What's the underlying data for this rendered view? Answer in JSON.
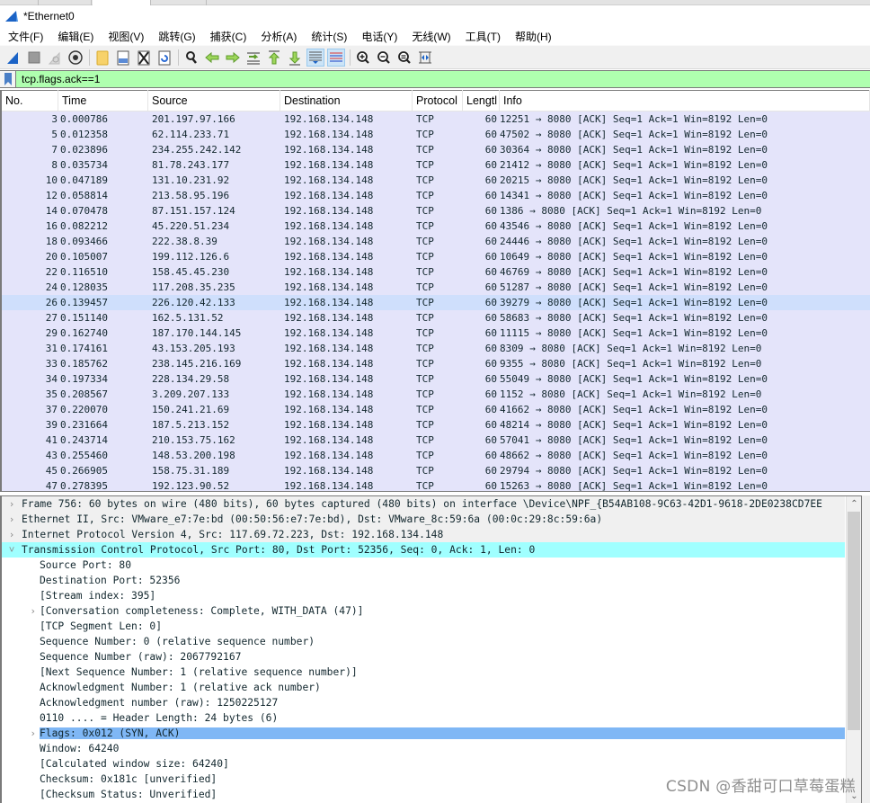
{
  "window": {
    "title": "*Ethernet0"
  },
  "menu": [
    {
      "label": "文件(F)"
    },
    {
      "label": "编辑(E)"
    },
    {
      "label": "视图(V)"
    },
    {
      "label": "跳转(G)"
    },
    {
      "label": "捕获(C)"
    },
    {
      "label": "分析(A)"
    },
    {
      "label": "统计(S)"
    },
    {
      "label": "电话(Y)"
    },
    {
      "label": "无线(W)"
    },
    {
      "label": "工具(T)"
    },
    {
      "label": "帮助(H)"
    }
  ],
  "toolbar": {
    "buttons": [
      {
        "icon": "shark-fin-start-capture-icon"
      },
      {
        "icon": "stop-capture-icon"
      },
      {
        "icon": "restart-capture-icon"
      },
      {
        "icon": "capture-options-gear-icon"
      },
      {
        "icon": "open-file-folder-icon"
      },
      {
        "icon": "save-file-icon"
      },
      {
        "icon": "close-file-icon"
      },
      {
        "icon": "reload-file-icon"
      },
      {
        "icon": "find-packet-magnifier-icon"
      },
      {
        "icon": "go-back-arrow-icon"
      },
      {
        "icon": "go-forward-arrow-icon"
      },
      {
        "icon": "go-to-packet-icon"
      },
      {
        "icon": "go-first-packet-icon"
      },
      {
        "icon": "go-last-packet-icon"
      },
      {
        "icon": "auto-scroll-icon",
        "active": true
      },
      {
        "icon": "colorize-icon",
        "active": true
      },
      {
        "icon": "zoom-in-icon"
      },
      {
        "icon": "zoom-out-icon"
      },
      {
        "icon": "zoom-normal-icon"
      },
      {
        "icon": "resize-columns-icon"
      }
    ]
  },
  "filter": {
    "value": "tcp.flags.ack==1"
  },
  "packet_list": {
    "columns": [
      "No.",
      "Time",
      "Source",
      "Destination",
      "Protocol",
      "Lengtl",
      "Info"
    ],
    "rows": [
      {
        "no": "3",
        "time": "0.000786",
        "src": "201.197.97.166",
        "dst": "192.168.134.148",
        "proto": "TCP",
        "len": "60",
        "info": "12251 → 8080 [ACK] Seq=1 Ack=1 Win=8192 Len=0"
      },
      {
        "no": "5",
        "time": "0.012358",
        "src": "62.114.233.71",
        "dst": "192.168.134.148",
        "proto": "TCP",
        "len": "60",
        "info": "47502 → 8080 [ACK] Seq=1 Ack=1 Win=8192 Len=0"
      },
      {
        "no": "7",
        "time": "0.023896",
        "src": "234.255.242.142",
        "dst": "192.168.134.148",
        "proto": "TCP",
        "len": "60",
        "info": "30364 → 8080 [ACK] Seq=1 Ack=1 Win=8192 Len=0"
      },
      {
        "no": "8",
        "time": "0.035734",
        "src": "81.78.243.177",
        "dst": "192.168.134.148",
        "proto": "TCP",
        "len": "60",
        "info": "21412 → 8080 [ACK] Seq=1 Ack=1 Win=8192 Len=0"
      },
      {
        "no": "10",
        "time": "0.047189",
        "src": "131.10.231.92",
        "dst": "192.168.134.148",
        "proto": "TCP",
        "len": "60",
        "info": "20215 → 8080 [ACK] Seq=1 Ack=1 Win=8192 Len=0"
      },
      {
        "no": "12",
        "time": "0.058814",
        "src": "213.58.95.196",
        "dst": "192.168.134.148",
        "proto": "TCP",
        "len": "60",
        "info": "14341 → 8080 [ACK] Seq=1 Ack=1 Win=8192 Len=0"
      },
      {
        "no": "14",
        "time": "0.070478",
        "src": "87.151.157.124",
        "dst": "192.168.134.148",
        "proto": "TCP",
        "len": "60",
        "info": "1386 → 8080 [ACK] Seq=1 Ack=1 Win=8192 Len=0"
      },
      {
        "no": "16",
        "time": "0.082212",
        "src": "45.220.51.234",
        "dst": "192.168.134.148",
        "proto": "TCP",
        "len": "60",
        "info": "43546 → 8080 [ACK] Seq=1 Ack=1 Win=8192 Len=0"
      },
      {
        "no": "18",
        "time": "0.093466",
        "src": "222.38.8.39",
        "dst": "192.168.134.148",
        "proto": "TCP",
        "len": "60",
        "info": "24446 → 8080 [ACK] Seq=1 Ack=1 Win=8192 Len=0"
      },
      {
        "no": "20",
        "time": "0.105007",
        "src": "199.112.126.6",
        "dst": "192.168.134.148",
        "proto": "TCP",
        "len": "60",
        "info": "10649 → 8080 [ACK] Seq=1 Ack=1 Win=8192 Len=0"
      },
      {
        "no": "22",
        "time": "0.116510",
        "src": "158.45.45.230",
        "dst": "192.168.134.148",
        "proto": "TCP",
        "len": "60",
        "info": "46769 → 8080 [ACK] Seq=1 Ack=1 Win=8192 Len=0"
      },
      {
        "no": "24",
        "time": "0.128035",
        "src": "117.208.35.235",
        "dst": "192.168.134.148",
        "proto": "TCP",
        "len": "60",
        "info": "51287 → 8080 [ACK] Seq=1 Ack=1 Win=8192 Len=0"
      },
      {
        "no": "26",
        "time": "0.139457",
        "src": "226.120.42.133",
        "dst": "192.168.134.148",
        "proto": "TCP",
        "len": "60",
        "info": "39279 → 8080 [ACK] Seq=1 Ack=1 Win=8192 Len=0",
        "hover": true
      },
      {
        "no": "27",
        "time": "0.151140",
        "src": "162.5.131.52",
        "dst": "192.168.134.148",
        "proto": "TCP",
        "len": "60",
        "info": "58683 → 8080 [ACK] Seq=1 Ack=1 Win=8192 Len=0"
      },
      {
        "no": "29",
        "time": "0.162740",
        "src": "187.170.144.145",
        "dst": "192.168.134.148",
        "proto": "TCP",
        "len": "60",
        "info": "11115 → 8080 [ACK] Seq=1 Ack=1 Win=8192 Len=0"
      },
      {
        "no": "31",
        "time": "0.174161",
        "src": "43.153.205.193",
        "dst": "192.168.134.148",
        "proto": "TCP",
        "len": "60",
        "info": "8309 → 8080 [ACK] Seq=1 Ack=1 Win=8192 Len=0"
      },
      {
        "no": "33",
        "time": "0.185762",
        "src": "238.145.216.169",
        "dst": "192.168.134.148",
        "proto": "TCP",
        "len": "60",
        "info": "9355 → 8080 [ACK] Seq=1 Ack=1 Win=8192 Len=0"
      },
      {
        "no": "34",
        "time": "0.197334",
        "src": "228.134.29.58",
        "dst": "192.168.134.148",
        "proto": "TCP",
        "len": "60",
        "info": "55049 → 8080 [ACK] Seq=1 Ack=1 Win=8192 Len=0"
      },
      {
        "no": "35",
        "time": "0.208567",
        "src": "3.209.207.133",
        "dst": "192.168.134.148",
        "proto": "TCP",
        "len": "60",
        "info": "1152 → 8080 [ACK] Seq=1 Ack=1 Win=8192 Len=0"
      },
      {
        "no": "37",
        "time": "0.220070",
        "src": "150.241.21.69",
        "dst": "192.168.134.148",
        "proto": "TCP",
        "len": "60",
        "info": "41662 → 8080 [ACK] Seq=1 Ack=1 Win=8192 Len=0"
      },
      {
        "no": "39",
        "time": "0.231664",
        "src": "187.5.213.152",
        "dst": "192.168.134.148",
        "proto": "TCP",
        "len": "60",
        "info": "48214 → 8080 [ACK] Seq=1 Ack=1 Win=8192 Len=0"
      },
      {
        "no": "41",
        "time": "0.243714",
        "src": "210.153.75.162",
        "dst": "192.168.134.148",
        "proto": "TCP",
        "len": "60",
        "info": "57041 → 8080 [ACK] Seq=1 Ack=1 Win=8192 Len=0"
      },
      {
        "no": "43",
        "time": "0.255460",
        "src": "148.53.200.198",
        "dst": "192.168.134.148",
        "proto": "TCP",
        "len": "60",
        "info": "48662 → 8080 [ACK] Seq=1 Ack=1 Win=8192 Len=0"
      },
      {
        "no": "45",
        "time": "0.266905",
        "src": "158.75.31.189",
        "dst": "192.168.134.148",
        "proto": "TCP",
        "len": "60",
        "info": "29794 → 8080 [ACK] Seq=1 Ack=1 Win=8192 Len=0"
      },
      {
        "no": "47",
        "time": "0.278395",
        "src": "192.123.90.52",
        "dst": "192.168.134.148",
        "proto": "TCP",
        "len": "60",
        "info": "15263 → 8080 [ACK] Seq=1 Ack=1 Win=8192 Len=0"
      }
    ]
  },
  "details": {
    "rows": [
      {
        "level": 0,
        "expander": "collapsed",
        "style": "top",
        "text": "Frame 756: 60 bytes on wire (480 bits), 60 bytes captured (480 bits) on interface \\Device\\NPF_{B54AB108-9C63-42D1-9618-2DE0238CD7EE"
      },
      {
        "level": 0,
        "expander": "collapsed",
        "style": "top",
        "text": "Ethernet II, Src: VMware_e7:7e:bd (00:50:56:e7:7e:bd), Dst: VMware_8c:59:6a (00:0c:29:8c:59:6a)"
      },
      {
        "level": 0,
        "expander": "collapsed",
        "style": "top",
        "text": "Internet Protocol Version 4, Src: 117.69.72.223, Dst: 192.168.134.148"
      },
      {
        "level": 0,
        "expander": "expanded",
        "style": "cyan",
        "text": "Transmission Control Protocol, Src Port: 80, Dst Port: 52356, Seq: 0, Ack: 1, Len: 0"
      },
      {
        "level": 1,
        "expander": "none",
        "style": "",
        "text": "Source Port: 80"
      },
      {
        "level": 1,
        "expander": "none",
        "style": "",
        "text": "Destination Port: 52356"
      },
      {
        "level": 1,
        "expander": "none",
        "style": "",
        "text": "[Stream index: 395]"
      },
      {
        "level": 1,
        "expander": "collapsed",
        "style": "",
        "text": "[Conversation completeness: Complete, WITH_DATA (47)]"
      },
      {
        "level": 1,
        "expander": "none",
        "style": "",
        "text": "[TCP Segment Len: 0]"
      },
      {
        "level": 1,
        "expander": "none",
        "style": "",
        "text": "Sequence Number: 0    (relative sequence number)"
      },
      {
        "level": 1,
        "expander": "none",
        "style": "",
        "text": "Sequence Number (raw): 2067792167"
      },
      {
        "level": 1,
        "expander": "none",
        "style": "",
        "text": "[Next Sequence Number: 1    (relative sequence number)]"
      },
      {
        "level": 1,
        "expander": "none",
        "style": "",
        "text": "Acknowledgment Number: 1    (relative ack number)"
      },
      {
        "level": 1,
        "expander": "none",
        "style": "",
        "text": "Acknowledgment number (raw): 1250225127"
      },
      {
        "level": 1,
        "expander": "none",
        "style": "",
        "text": "0110 .... = Header Length: 24 bytes (6)"
      },
      {
        "level": 1,
        "expander": "collapsed",
        "style": "blue",
        "text": "Flags: 0x012 (SYN, ACK)"
      },
      {
        "level": 1,
        "expander": "none",
        "style": "",
        "text": "Window: 64240"
      },
      {
        "level": 1,
        "expander": "none",
        "style": "",
        "text": "[Calculated window size: 64240]"
      },
      {
        "level": 1,
        "expander": "none",
        "style": "",
        "text": "Checksum: 0x181c [unverified]"
      },
      {
        "level": 1,
        "expander": "none",
        "style": "",
        "text": "[Checksum Status: Unverified]"
      }
    ]
  },
  "watermark": "CSDN @香甜可口草莓蛋糕",
  "colors": {
    "filter_valid_bg": "#afffaf",
    "packet_row_bg": "#e4e4fa",
    "packet_row_hover": "#cfdffc",
    "detail_selected_protocol": "#a0ffff",
    "detail_selected_field": "#7fb7f5"
  }
}
